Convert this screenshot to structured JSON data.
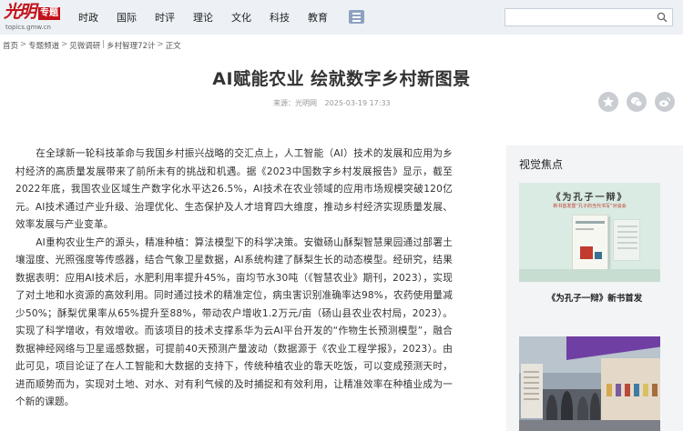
{
  "header": {
    "logo_script": "光明",
    "logo_badge": "专题",
    "logo_url": "topics.gmw.cn",
    "nav": [
      "时政",
      "国际",
      "时评",
      "理论",
      "文化",
      "科技",
      "教育"
    ],
    "menu_icon": "menu-list-icon",
    "search": {
      "value": "",
      "placeholder": "",
      "icon": "search-icon"
    }
  },
  "breadcrumb": {
    "items": [
      "首页",
      "专题频道",
      "见微调研",
      "乡村智理72计",
      "正文"
    ],
    "separators": [
      ">",
      ">",
      "|",
      ">"
    ]
  },
  "article": {
    "title": "AI赋能农业 绘就数字乡村新图景",
    "source": "来源：光明网",
    "date": "2025-03-19 17:33",
    "share_icons": [
      "qzone-star-icon",
      "wechat-icon",
      "weibo-icon"
    ],
    "paragraphs": [
      "在全球新一轮科技革命与我国乡村振兴战略的交汇点上，人工智能（AI）技术的发展和应用为乡村经济的高质量发展带来了前所未有的挑战和机遇。据《2023中国数字乡村发展报告》显示，截至2022年底，我国农业区域生产数字化水平达26.5%，AI技术在农业领域的应用市场规模突破120亿元。AI技术通过产业升级、治理优化、生态保护及人才培育四大维度，推动乡村经济实现质量发展、效率发展与产业变革。",
      "AI重构农业生产的源头，精准种植：算法模型下的科学决策。安徽砀山酥梨智慧果园通过部署土壤湿度、光照强度等传感器，结合气象卫星数据，AI系统构建了酥梨生长的动态模型。经研究，结果数据表明：应用AI技术后，水肥利用率提升45%，亩均节水30吨（《智慧农业》期刊，2023），实现了对土地和水资源的高效利用。同时通过技术的精准定位，病虫害识别准确率达98%，农药使用量减少50%；酥梨优果率从65%提升至88%，带动农户增收1.2万元/亩（砀山县农业农村局，2023）。实现了科学增收，有效增收。而该项目的技术支撑系华为云AI平台开发的“作物生长预测模型”，融合数据神经网络与卫星遥感数据，可提前40天预测产量波动（数据源于《农业工程学报》，2023）。由此可见，项目论证了在人工智能和大数据的支持下，传统种植农业的靠天吃饭，可以变成预测天时，进而顺势而为，实现对土地、对水、对有利气候的及时捕捉和有效利用，让精准效率在种植业成为一个新的课题。"
    ]
  },
  "sidebar": {
    "title": "视觉焦点",
    "card1": {
      "headline": "《为孔子一辩》",
      "subline": "新书首发暨“孔子的当代书写”对谈会",
      "caption": "《为孔子一辩》新书首发"
    },
    "card2": {
      "awning_text": ""
    }
  },
  "colors": {
    "brand_red": "#c4121a",
    "header_bg": "#edf1f5",
    "sidebar_bg": "#f3f4f6",
    "share_icon_bg": "#c9cdd2"
  }
}
